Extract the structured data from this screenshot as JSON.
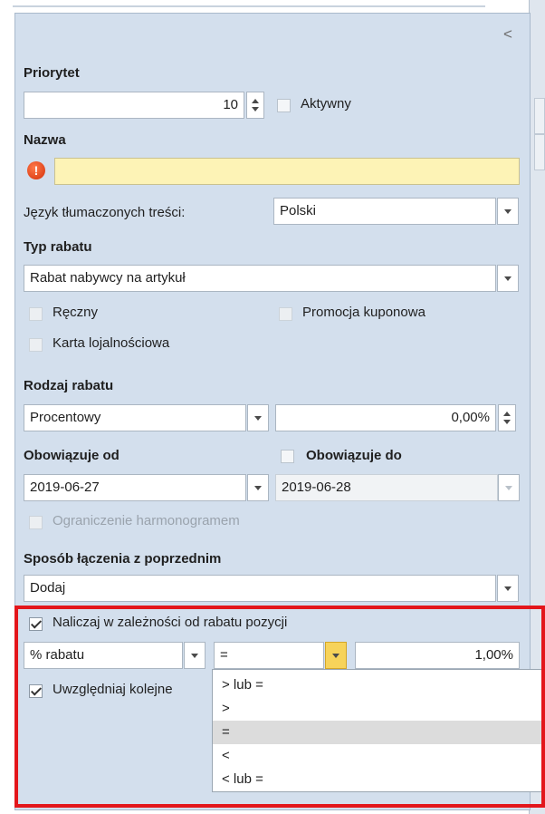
{
  "priorytet": {
    "label": "Priorytet",
    "value": "10",
    "aktywny_label": "Aktywny"
  },
  "nazwa": {
    "label": "Nazwa",
    "value": "",
    "warning_icon": "exclamation-icon"
  },
  "jezyk": {
    "label": "Język tłumaczonych treści:",
    "value": "Polski"
  },
  "typ_rabatu": {
    "label": "Typ rabatu",
    "value": "Rabat nabywcy na artykuł",
    "reczny_label": "Ręczny",
    "promocja_label": "Promocja kuponowa",
    "karta_label": "Karta lojalnościowa"
  },
  "rodzaj_rabatu": {
    "label": "Rodzaj rabatu",
    "type_value": "Procentowy",
    "percent_value": "0,00%"
  },
  "obowiazuje": {
    "od_label": "Obowiązuje od",
    "od_value": "2019-06-27",
    "do_label": "Obowiązuje do",
    "do_value": "2019-06-28",
    "harmonogram_label": "Ograniczenie harmonogramem"
  },
  "sposob": {
    "label": "Sposób łączenia z poprzednim",
    "value": "Dodaj"
  },
  "naliczaj": {
    "checkbox_label": "Naliczaj w zależności od rabatu pozycji",
    "basis_value": "% rabatu",
    "operator_value": "=",
    "amount_value": "1,00%",
    "uwzgledniaj_label": "Uwzględniaj kolejne",
    "operator_options": [
      "> lub =",
      ">",
      "=",
      "<",
      "< lub ="
    ],
    "selected_option": "="
  },
  "panel": {
    "collapse_glyph": "<"
  },
  "colors": {
    "panel_bg": "#d3dfed",
    "required_bg": "#fdf3b6",
    "highlight": "#e3161b",
    "active_dropdown": "#f7d35a"
  }
}
